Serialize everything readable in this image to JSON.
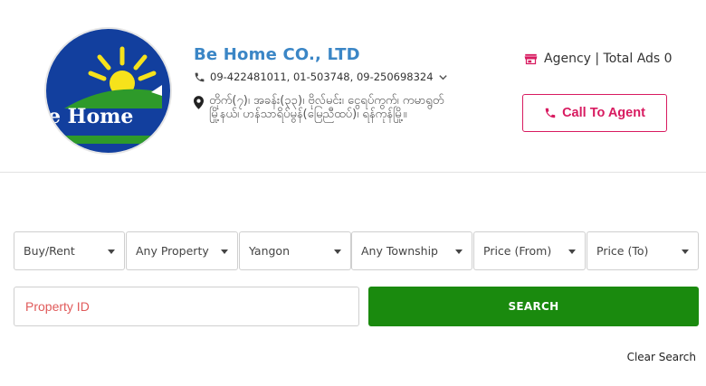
{
  "agency": {
    "logo_text": "e Home",
    "name": "Be Home CO., LTD",
    "phones": "09-422481011, 01-503748, 09-250698324",
    "address": "တိုက်(၇)၊ အခန်း(၃၃)၊ ဗိုလ်မင်း၊ ငွေရပ်ကွက်၊ ကမာရွတ်\nမြို့နယ်၊ ဟန်သာရိပ်မွန်(မြေညီထပ်)၊ ရန်ကုန်မြို့။",
    "type_and_ads": "Agency | Total Ads 0",
    "call_label": "Call To Agent"
  },
  "filters": [
    {
      "label": "Buy/Rent"
    },
    {
      "label": "Any Property"
    },
    {
      "label": "Yangon"
    },
    {
      "label": "Any Township"
    },
    {
      "label": "Price (From)"
    },
    {
      "label": "Price (To)"
    }
  ],
  "search": {
    "property_id_placeholder": "Property ID",
    "search_label": "SEARCH",
    "clear_label": "Clear Search"
  },
  "colors": {
    "brand_blue": "#3b86c6",
    "call_pink": "#d81b60",
    "search_green": "#1a8a0e",
    "placeholder_red": "#e05a5a"
  },
  "icons": {
    "phone": "phone-icon",
    "expand": "chevron-down-icon",
    "location": "map-marker-icon",
    "agency": "store-icon",
    "call": "phone-icon"
  }
}
